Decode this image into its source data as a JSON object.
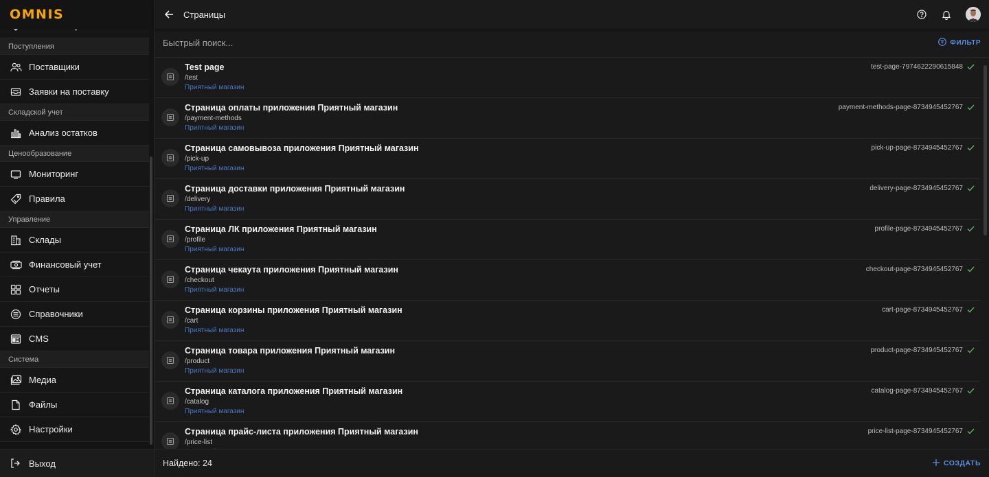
{
  "logo": "OMNIS",
  "sidebar": {
    "top_item": {
      "label": "Списки избранных",
      "icon": "heart-icon"
    },
    "sections": [
      {
        "title": "Поступления",
        "items": [
          {
            "label": "Поставщики",
            "icon": "users-icon"
          },
          {
            "label": "Заявки на поставку",
            "icon": "inbox-icon"
          }
        ]
      },
      {
        "title": "Складской учет",
        "items": [
          {
            "label": "Анализ остатков",
            "icon": "bar-chart-icon"
          }
        ]
      },
      {
        "title": "Ценообразование",
        "items": [
          {
            "label": "Мониторинг",
            "icon": "monitor-icon"
          },
          {
            "label": "Правила",
            "icon": "tag-icon"
          }
        ]
      },
      {
        "title": "Управление",
        "items": [
          {
            "label": "Склады",
            "icon": "building-icon"
          },
          {
            "label": "Финансовый учет",
            "icon": "money-icon"
          },
          {
            "label": "Отчеты",
            "icon": "grid-icon"
          },
          {
            "label": "Справочники",
            "icon": "list-circle-icon"
          },
          {
            "label": "CMS",
            "icon": "cms-icon"
          }
        ]
      },
      {
        "title": "Система",
        "items": [
          {
            "label": "Медиа",
            "icon": "image-icon"
          },
          {
            "label": "Файлы",
            "icon": "file-icon"
          },
          {
            "label": "Настройки",
            "icon": "gear-icon"
          }
        ]
      }
    ],
    "logout": {
      "label": "Выход",
      "icon": "logout-icon"
    }
  },
  "header": {
    "title": "Страницы"
  },
  "search": {
    "placeholder": "Быстрый поиск...",
    "value": ""
  },
  "filter_label": "ФИЛЬТР",
  "shop_label": "Приятный магазин",
  "rows": [
    {
      "title": "Test page",
      "path": "/test",
      "code": "test-page-7974622290615848"
    },
    {
      "title": "Страница оплаты приложения Приятный магазин",
      "path": "/payment-methods",
      "code": "payment-methods-page-8734945452767"
    },
    {
      "title": "Страница самовывоза приложения Приятный магазин",
      "path": "/pick-up",
      "code": "pick-up-page-8734945452767"
    },
    {
      "title": "Страница доставки приложения Приятный магазин",
      "path": "/delivery",
      "code": "delivery-page-8734945452767"
    },
    {
      "title": "Страница ЛК приложения Приятный магазин",
      "path": "/profile",
      "code": "profile-page-8734945452767"
    },
    {
      "title": "Страница чекаута приложения Приятный магазин",
      "path": "/checkout",
      "code": "checkout-page-8734945452767"
    },
    {
      "title": "Страница корзины приложения Приятный магазин",
      "path": "/cart",
      "code": "cart-page-8734945452767"
    },
    {
      "title": "Страница товара приложения Приятный магазин",
      "path": "/product",
      "code": "product-page-8734945452767"
    },
    {
      "title": "Страница каталога приложения Приятный магазин",
      "path": "/catalog",
      "code": "catalog-page-8734945452767"
    },
    {
      "title": "Страница прайс-листа приложения Приятный магазин",
      "path": "/price-list",
      "code": "price-list-page-8734945452767"
    }
  ],
  "footer": {
    "found": "Найдено: 24",
    "create_label": "СОЗДАТЬ"
  },
  "colors": {
    "accent": "#5a8fe0",
    "logo": "#f5a400",
    "shop_link": "#4a78c7",
    "check": "#5fb35f"
  }
}
